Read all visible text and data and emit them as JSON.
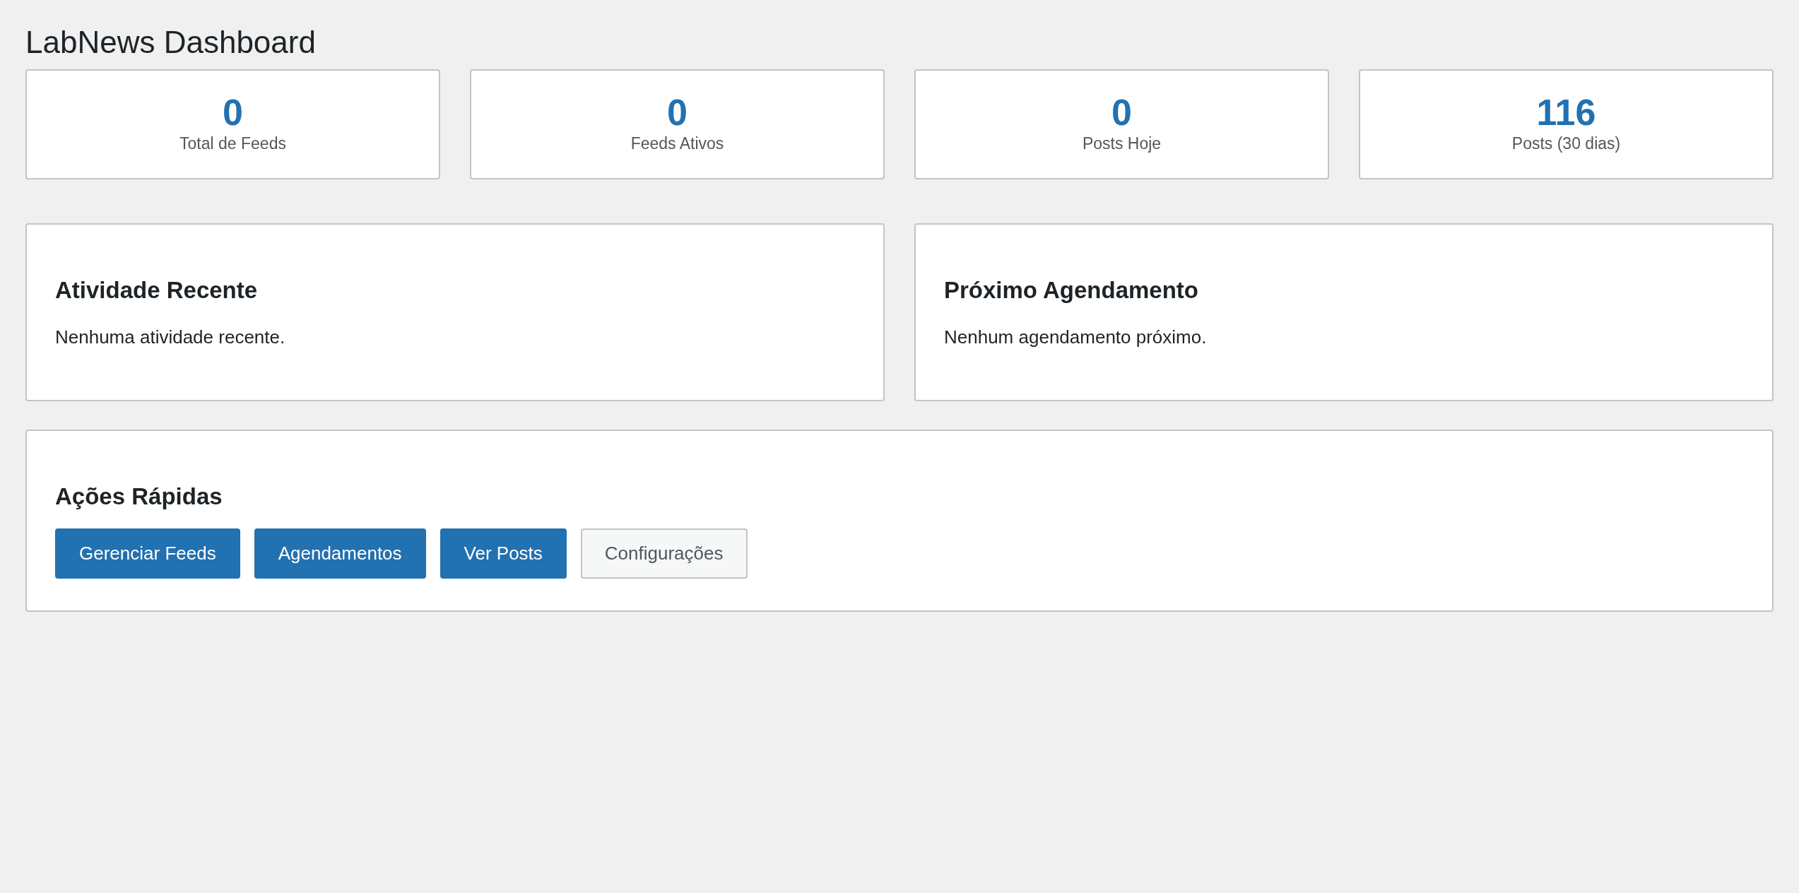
{
  "title": "LabNews Dashboard",
  "stats": [
    {
      "value": "0",
      "label": "Total de Feeds"
    },
    {
      "value": "0",
      "label": "Feeds Ativos"
    },
    {
      "value": "0",
      "label": "Posts Hoje"
    },
    {
      "value": "116",
      "label": "Posts (30 dias)"
    }
  ],
  "panels": [
    {
      "heading": "Atividade Recente",
      "text": "Nenhuma atividade recente."
    },
    {
      "heading": "Próximo Agendamento",
      "text": "Nenhum agendamento próximo."
    }
  ],
  "quick_actions": {
    "heading": "Ações Rápidas",
    "buttons": [
      {
        "label": "Gerenciar Feeds",
        "kind": "primary"
      },
      {
        "label": "Agendamentos",
        "kind": "primary"
      },
      {
        "label": "Ver Posts",
        "kind": "primary"
      },
      {
        "label": "Configurações",
        "kind": "secondary"
      }
    ]
  }
}
